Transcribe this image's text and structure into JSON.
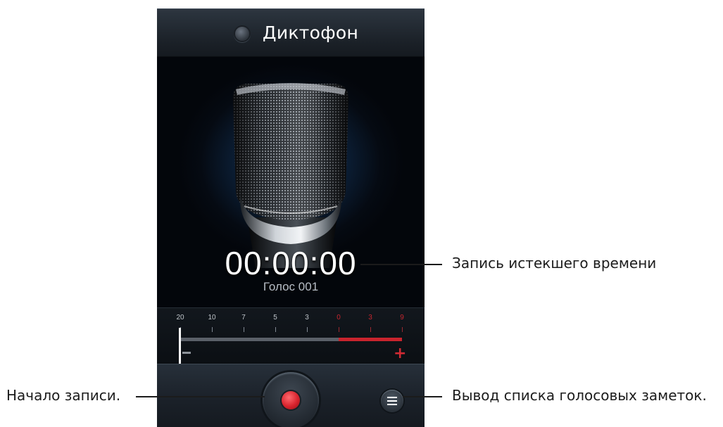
{
  "app": {
    "title": "Диктофон"
  },
  "recorder": {
    "elapsed_time": "00:00:00",
    "file_name": "Голос 001"
  },
  "level_meter": {
    "scale_labels": [
      "20",
      "10",
      "7",
      "5",
      "3",
      "0",
      "3",
      "9"
    ],
    "red_labels_from_index": 5,
    "current_level": 0,
    "minus_symbol": "−",
    "plus_symbol": "+"
  },
  "callouts": {
    "elapsed_time": "Запись истекшего времени",
    "start_recording": "Начало записи.",
    "voice_notes_list": "Вывод списка голосовых заметок."
  },
  "colors": {
    "accent_red": "#c9242d",
    "background": "#05090f"
  },
  "icons": {
    "app_icon": "recorder-app-icon",
    "record_button": "record-dot-icon",
    "list_button": "list-menu-icon",
    "microphone": "microphone-icon"
  }
}
